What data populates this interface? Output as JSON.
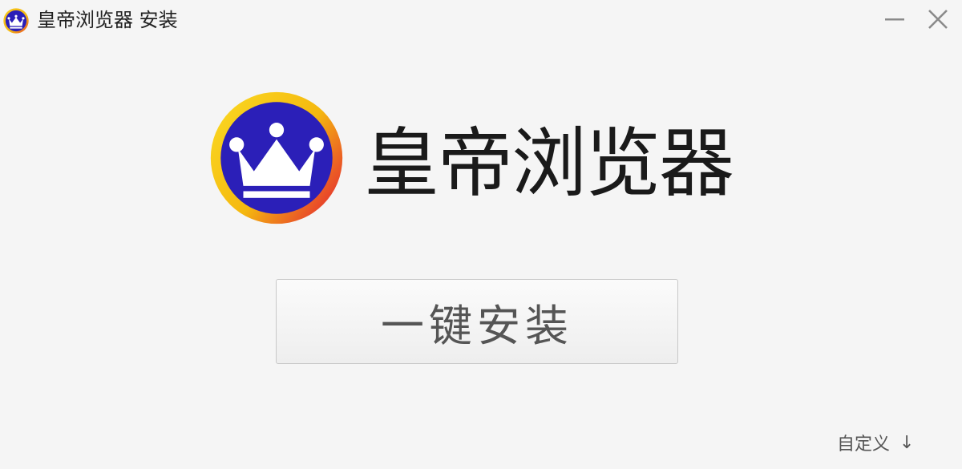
{
  "window": {
    "title": "皇帝浏览器  安装"
  },
  "brand": {
    "name": "皇帝浏览器",
    "logo_icon": "crown-icon",
    "colors": {
      "logo_fill": "#2b1fb8",
      "logo_ring": "#f5b80f",
      "logo_ring_accent": "#e8452a",
      "crown": "#ffffff"
    }
  },
  "install": {
    "button_label": "一键安装"
  },
  "custom": {
    "label": "自定义",
    "arrow": "↓"
  },
  "controls": {
    "minimize_icon": "minimize-icon",
    "close_icon": "close-icon"
  }
}
